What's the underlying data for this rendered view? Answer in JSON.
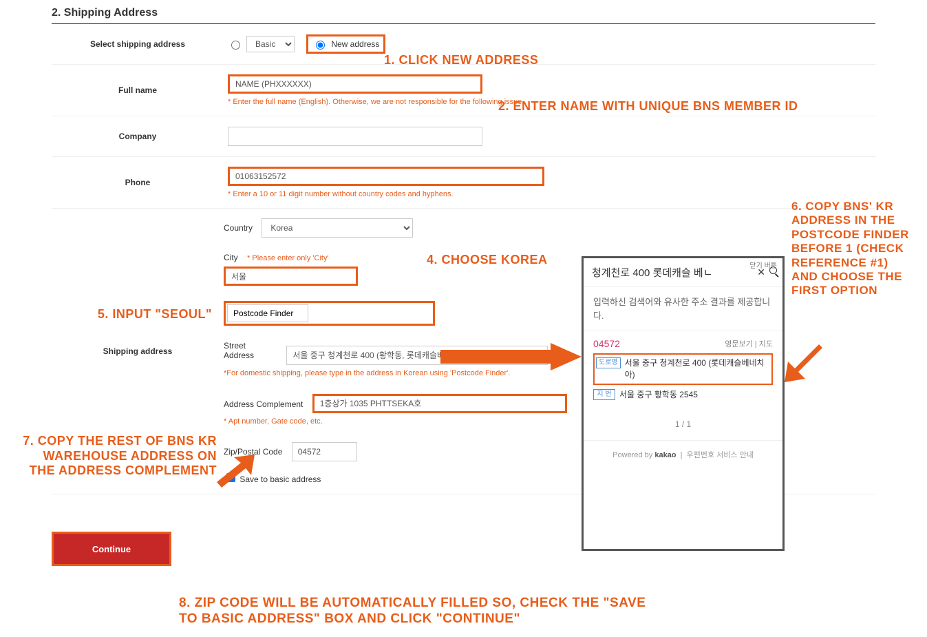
{
  "section_title": "2. Shipping Address",
  "rows": {
    "select_label": "Select shipping address",
    "basic_option": "Basic",
    "new_option": "New address",
    "fullname_label": "Full name",
    "fullname_value": "NAME (PHXXXXXX)",
    "fullname_hint": "* Enter the full name (English). Otherwise, we are not responsible for the following issue.",
    "company_label": "Company",
    "company_value": "",
    "phone_label": "Phone",
    "phone_value": "01063152572",
    "phone_hint": "* Enter a 10 or 11 digit number without country codes and hyphens.",
    "shipaddr_label": "Shipping address",
    "country_sublab": "Country",
    "country_value": "Korea",
    "city_sublab": "City",
    "city_hint": "* Please enter only 'City'",
    "city_value": "서울",
    "postcode_btn": "Postcode Finder",
    "street_sublab": "Street Address",
    "street_value": "서울 중구 청계천로 400 (황학동, 롯데캐슬베네치아)",
    "street_hint": "*For domestic shipping, please type in the address in Korean using 'Postcode Finder'.",
    "addrcomp_sublab": "Address Complement",
    "addrcomp_value": "1층상가 1035 PHTTSEKA호",
    "addrcomp_hint": "* Apt number, Gate code, etc.",
    "zip_sublab": "Zip/Postal Code",
    "zip_value": "04572",
    "save_chk": "Save to basic address"
  },
  "continue_btn": "Continue",
  "annotations": {
    "a1": "1. CLICK NEW ADDRESS",
    "a2": "2. ENTER NAME WITH UNIQUE BNS MEMBER ID",
    "a4": "4. CHOOSE KOREA",
    "a5": "5. INPUT \"SEOUL\"",
    "a6": "6. COPY BNS' KR ADDRESS IN THE POSTCODE FINDER BEFORE 1 (CHECK REFERENCE #1) AND CHOOSE THE FIRST OPTION",
    "a7": "7. COPY THE REST OF BNS KR WAREHOUSE ADDRESS ON THE ADDRESS COMPLEMENT",
    "a8": "8. ZIP CODE WILL BE AUTOMATICALLY FILLED SO, CHECK THE \"SAVE TO BASIC ADDRESS\" BOX AND CLICK \"CONTINUE\""
  },
  "popup": {
    "alt": "닫기 버튼",
    "query": "청계천로 400 롯데캐슬 베ㄴ",
    "msg": "입력하신 검색어와 유사한 주소 결과를 제공합니다.",
    "zip": "04572",
    "links": "영문보기  |  지도",
    "tag_road": "도로명",
    "road_addr": "서울 중구 청계천로 400 (롯데캐슬베네치아)",
    "tag_jibun": "지 번",
    "jibun_addr": "서울 중구 황학동 2545",
    "pager": "1 / 1",
    "footer_prefix": "Powered by",
    "footer_brand": "kakao",
    "footer_suffix": "우편번호 서비스 안내"
  }
}
